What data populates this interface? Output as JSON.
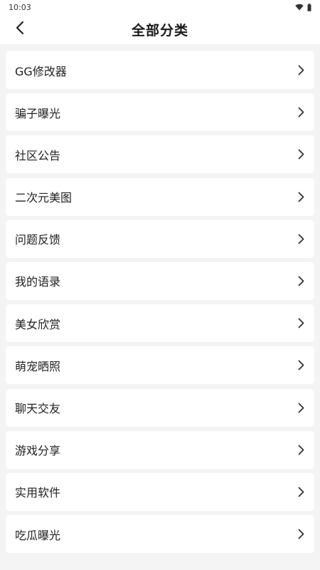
{
  "status_bar": {
    "time": "10:03",
    "icons": [
      "wifi-icon",
      "battery-icon"
    ]
  },
  "header": {
    "back_icon": "chevron-left-icon",
    "title": "全部分类"
  },
  "categories": [
    {
      "label": "GG修改器"
    },
    {
      "label": "骗子曝光"
    },
    {
      "label": "社区公告"
    },
    {
      "label": "二次元美图"
    },
    {
      "label": "问题反馈"
    },
    {
      "label": "我的语录"
    },
    {
      "label": "美女欣赏"
    },
    {
      "label": "萌宠晒照"
    },
    {
      "label": "聊天交友"
    },
    {
      "label": "游戏分享"
    },
    {
      "label": "实用软件"
    },
    {
      "label": "吃瓜曝光"
    }
  ],
  "item_icon": "chevron-right-icon",
  "colors": {
    "background": "#f4f4f4",
    "card": "#ffffff",
    "text": "#222222",
    "chevron": "#333333"
  }
}
